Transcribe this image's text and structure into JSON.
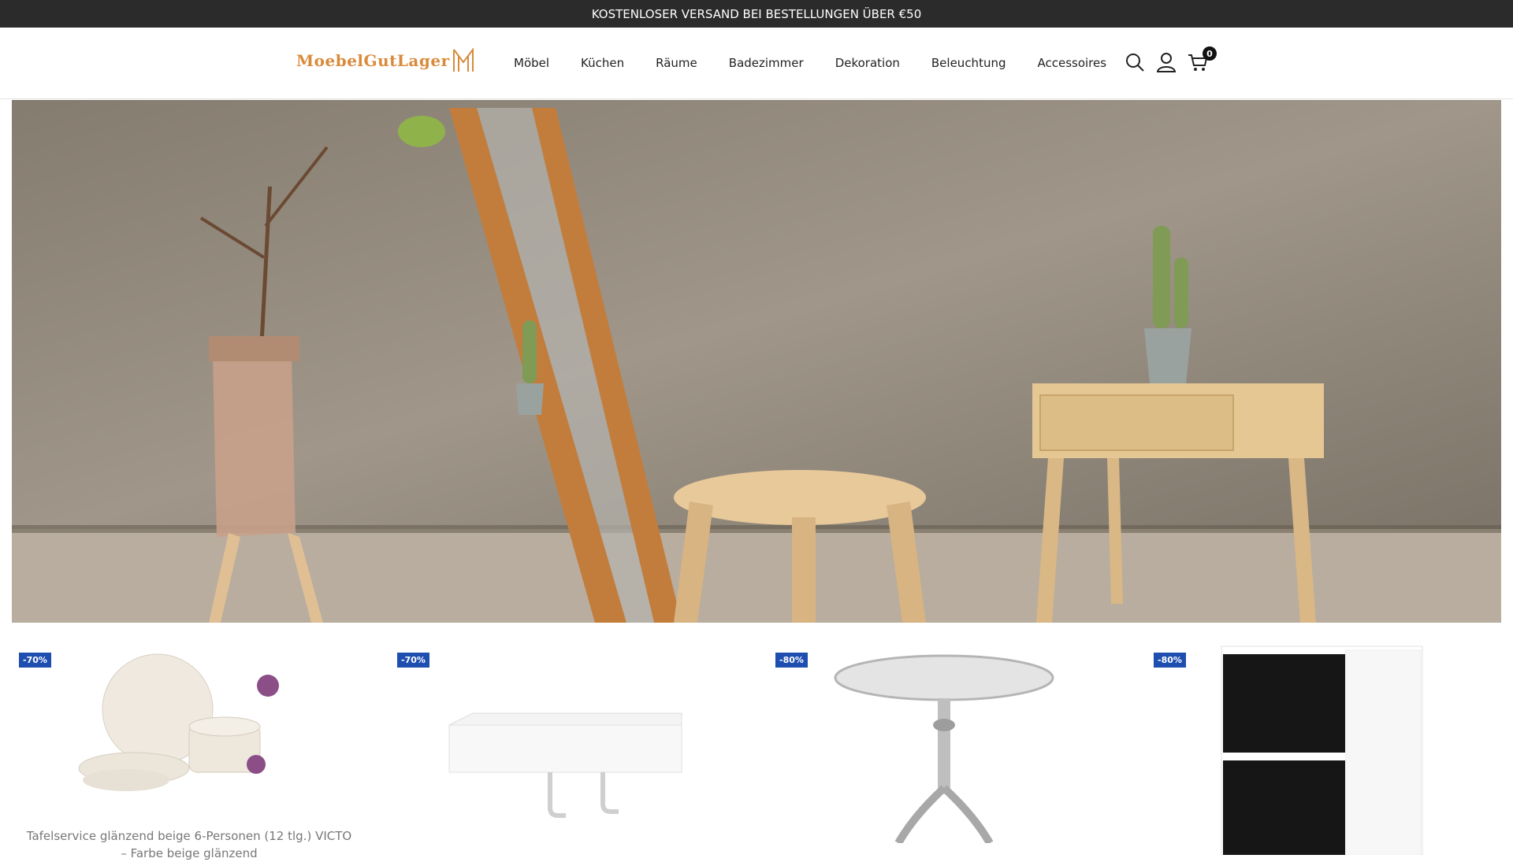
{
  "topbar": {
    "announcement": "KOSTENLOSER VERSAND BEI BESTELLUNGEN ÜBER €50"
  },
  "header": {
    "logo_text": "MoebelGutLager",
    "nav": [
      "Möbel",
      "Küchen",
      "Räume",
      "Badezimmer",
      "Dekoration",
      "Beleuchtung",
      "Accessoires"
    ],
    "icons": [
      "search-icon",
      "user-icon",
      "cart-icon"
    ],
    "cart_count": "0"
  },
  "hero": {
    "image": "furniture-scene-photo"
  },
  "products": [
    {
      "badge": "-70%",
      "title": "Tafelservice glänzend beige 6-Personen (12 tlg.) VICTO – Farbe beige glänzend",
      "image": "dinnerware-set"
    },
    {
      "badge": "-70%",
      "title": "",
      "image": "wall-shelf-hooks"
    },
    {
      "badge": "-80%",
      "title": "",
      "image": "silver-bistro-table"
    },
    {
      "badge": "-80%",
      "title": "",
      "image": "kitchen-drawer-cabinet"
    }
  ],
  "colors": {
    "topbar": "#2b2b2b",
    "logo": "#d98b3c",
    "badge": "#1e4fb0"
  }
}
